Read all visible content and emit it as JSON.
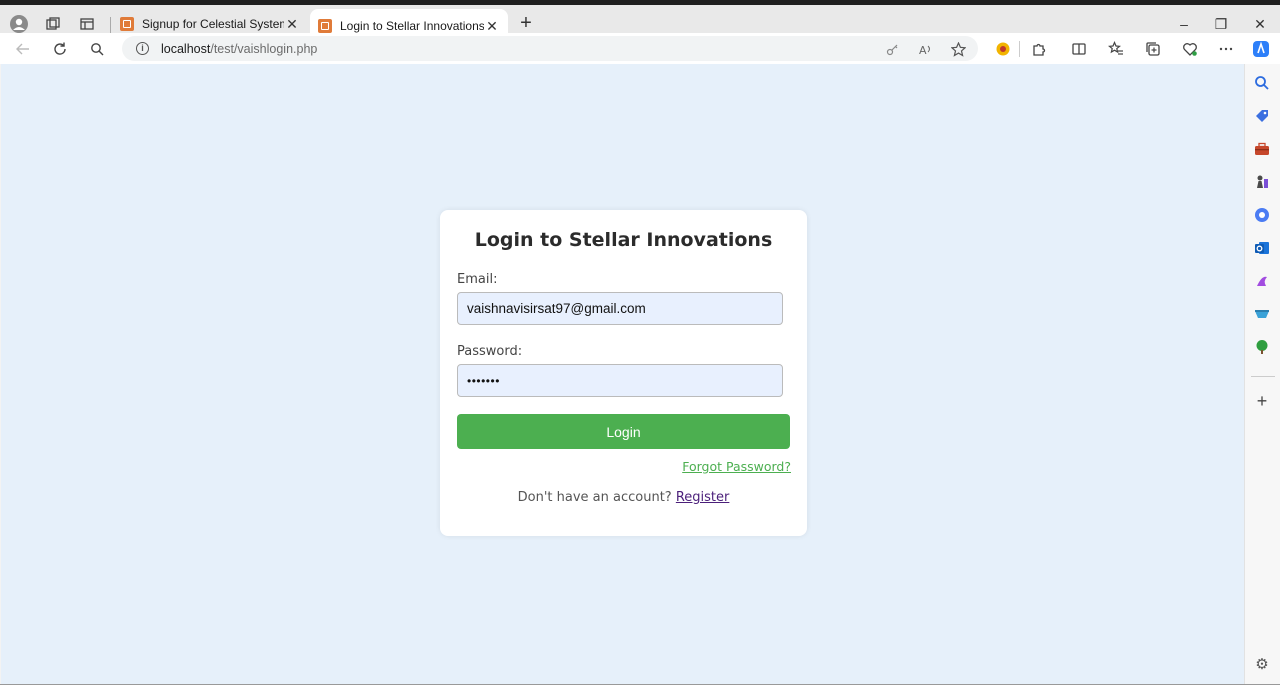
{
  "browser": {
    "tabs": [
      {
        "title": "Signup for Celestial Systems",
        "active": false
      },
      {
        "title": "Login to Stellar Innovations",
        "active": true
      }
    ],
    "url_host": "localhost",
    "url_path": "/test/vaishlogin.php",
    "window_controls": {
      "minimize": "–",
      "restore": "❐",
      "close": "✕"
    }
  },
  "page": {
    "heading": "Login to Stellar Innovations",
    "email_label": "Email:",
    "email_value": "vaishnavisirsat97@gmail.com",
    "password_label": "Password:",
    "password_value": "•••••••",
    "login_button": "Login",
    "forgot_link": "Forgot Password?",
    "register_prompt": "Don't have an account?",
    "register_link": "Register"
  },
  "colors": {
    "page_bg": "#e6f0fa",
    "card_bg": "#ffffff",
    "button_green": "#4caf50",
    "input_bg": "#e8f0fe",
    "register_link": "#4b1f7a"
  },
  "sidebar_icons": [
    "search-icon",
    "tag-icon",
    "toolbox-icon",
    "chess-icon",
    "copilot-icon",
    "outlook-icon",
    "designer-icon",
    "drop-icon",
    "tree-icon"
  ]
}
